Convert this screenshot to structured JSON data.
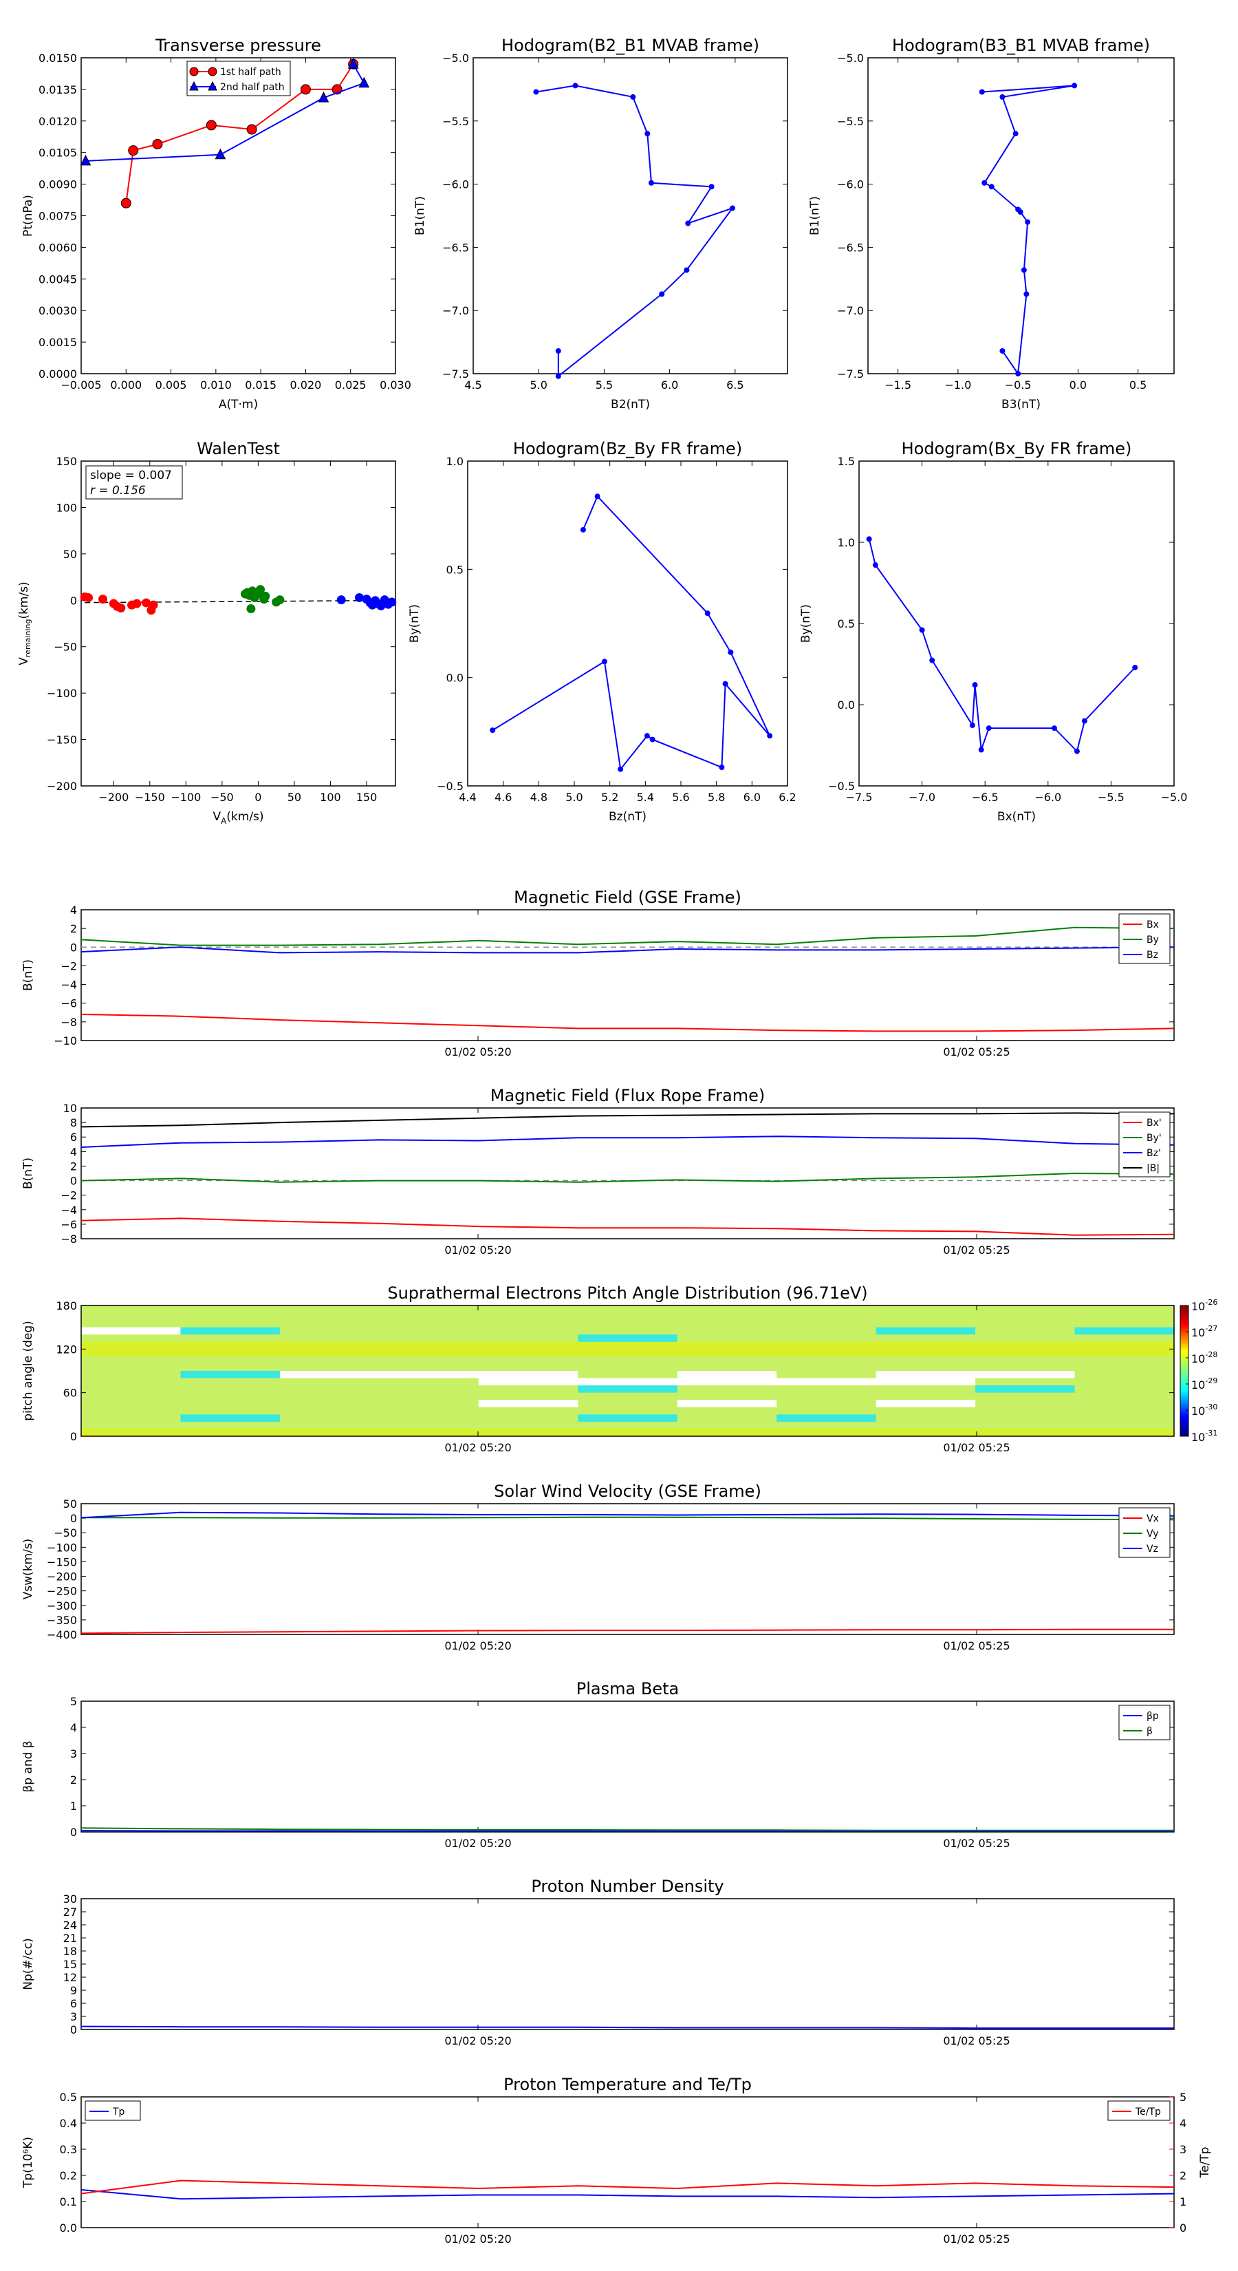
{
  "figure": {
    "background": "#ffffff"
  },
  "chart_data": [
    {
      "type": "line",
      "title": "Transverse pressure",
      "xlabel": "A(T·m)",
      "ylabel": "Pt(nPa)",
      "xlim": [
        -0.005,
        0.03
      ],
      "ylim": [
        0,
        0.015
      ],
      "xticks": [
        "−0.005",
        "0.000",
        "0.005",
        "0.010",
        "0.015",
        "0.020",
        "0.025",
        "0.030"
      ],
      "yticks": [
        "0.0000",
        "0.0015",
        "0.0030",
        "0.0045",
        "0.0060",
        "0.0075",
        "0.0090",
        "0.0105",
        "0.0120",
        "0.0135",
        "0.0150"
      ],
      "legend": "upper-center",
      "series": [
        {
          "name": "1st half path",
          "color": "#ff0000",
          "marker": "circle",
          "x": [
            0.0,
            0.0008,
            0.0035,
            0.0095,
            0.014,
            0.02,
            0.0235,
            0.0253
          ],
          "y": [
            0.0081,
            0.0106,
            0.0109,
            0.0118,
            0.0116,
            0.0135,
            0.0135,
            0.0147
          ]
        },
        {
          "name": "2nd half path",
          "color": "#0000ff",
          "marker": "triangle",
          "x": [
            -0.0045,
            0.0105,
            0.022,
            0.0265,
            0.0253
          ],
          "y": [
            0.0101,
            0.0104,
            0.0131,
            0.0138,
            0.0147
          ]
        }
      ]
    },
    {
      "type": "line",
      "title": "Hodogram(B2_B1 MVAB frame)",
      "xlabel": "B2(nT)",
      "ylabel": "B1(nT)",
      "xlim": [
        4.5,
        6.9
      ],
      "ylim": [
        -7.5,
        -5.0
      ],
      "xticks": [
        "4.5",
        "5.0",
        "5.5",
        "6.0",
        "6.5"
      ],
      "yticks": [
        "−7.5",
        "−7.0",
        "−6.5",
        "−6.0",
        "−5.5",
        "−5.0"
      ],
      "series": [
        {
          "color": "#0000ff",
          "x": [
            5.15,
            5.15,
            5.94,
            6.13,
            6.48,
            6.14,
            6.32,
            5.86,
            5.83,
            5.72,
            5.28,
            4.98
          ],
          "y": [
            -7.32,
            -7.52,
            -6.87,
            -6.68,
            -6.19,
            -6.31,
            -6.02,
            -5.99,
            -5.6,
            -5.31,
            -5.22,
            -5.27
          ]
        }
      ]
    },
    {
      "type": "line",
      "title": "Hodogram(B3_B1 MVAB frame)",
      "xlabel": "B3(nT)",
      "ylabel": "B1(nT)",
      "xlim": [
        -1.75,
        0.8
      ],
      "ylim": [
        -7.5,
        -5.0
      ],
      "xticks": [
        "−1.5",
        "−1.0",
        "−0.5",
        "0.0",
        "0.5"
      ],
      "yticks": [
        "−7.5",
        "−7.0",
        "−6.5",
        "−6.0",
        "−5.5",
        "−5.0"
      ],
      "series": [
        {
          "color": "#0000ff",
          "x": [
            -0.63,
            -0.5,
            -0.43,
            -0.45,
            -0.42,
            -0.48,
            -0.5,
            -0.72,
            -0.78,
            -0.52,
            -0.63,
            -0.03,
            -0.8
          ],
          "y": [
            -7.32,
            -7.5,
            -6.87,
            -6.68,
            -6.3,
            -6.22,
            -6.2,
            -6.02,
            -5.99,
            -5.6,
            -5.31,
            -5.22,
            -5.27
          ]
        }
      ]
    },
    {
      "type": "scatter",
      "title": "WalenTest",
      "xlabel": "V",
      "xlabel_sub": "A",
      "xlabel_unit": "(km/s)",
      "ylabel": "V",
      "ylabel_sub": "remaining",
      "ylabel_unit": "(km/s)",
      "xlim": [
        -245,
        190
      ],
      "ylim": [
        -250,
        190
      ],
      "xticks": [
        "−200",
        "−150",
        "−100",
        "−50",
        "0",
        "50",
        "100",
        "150"
      ],
      "yticks": [
        "−200",
        "−150",
        "−100",
        "−50",
        "0",
        "50",
        "100",
        "150"
      ],
      "annotation": [
        "slope = 0.007",
        "r = 0.156"
      ],
      "fit_line": {
        "x": [
          -240,
          190
        ],
        "y": [
          -1.7,
          1.3
        ],
        "color": "#000000",
        "dashed": true
      },
      "series": [
        {
          "color": "#ff0000",
          "x": [
            -240,
            -235,
            -215,
            -200,
            -195,
            -190,
            -175,
            -168,
            -155,
            -148,
            -145
          ],
          "y": [
            6,
            5,
            3,
            -3,
            -7,
            -9,
            -5,
            -3,
            -2,
            -12,
            -5
          ]
        },
        {
          "color": "#008000",
          "x": [
            -18,
            -15,
            -12,
            -10,
            -8,
            -5,
            0,
            3,
            8,
            10,
            25,
            30
          ],
          "y": [
            10,
            12,
            8,
            -10,
            14,
            5,
            10,
            16,
            3,
            7,
            -1,
            2
          ]
        },
        {
          "color": "#0000ff",
          "x": [
            115,
            140,
            150,
            155,
            158,
            162,
            165,
            170,
            175,
            180,
            185
          ],
          "y": [
            2,
            5,
            3,
            -2,
            -5,
            1,
            -3,
            -6,
            2,
            -4,
            -1
          ]
        }
      ]
    },
    {
      "type": "line",
      "title": "Hodogram(Bz_By FR frame)",
      "xlabel": "Bz(nT)",
      "ylabel": "By(nT)",
      "xlim": [
        4.4,
        6.2
      ],
      "ylim": [
        -0.55,
        1.2
      ],
      "xticks": [
        "4.4",
        "4.6",
        "4.8",
        "5.0",
        "5.2",
        "5.4",
        "5.6",
        "5.8",
        "6.0",
        "6.2"
      ],
      "yticks": [
        "−0.5",
        "0.0",
        "0.5",
        "1.0"
      ],
      "series": [
        {
          "color": "#0000ff",
          "x": [
            5.05,
            5.13,
            5.75,
            5.88,
            6.1,
            5.85,
            5.83,
            5.44,
            5.41,
            5.26,
            5.17,
            4.54
          ],
          "y": [
            0.83,
            1.01,
            0.38,
            0.17,
            -0.28,
            0.0,
            -0.45,
            -0.3,
            -0.28,
            -0.46,
            0.12,
            -0.25
          ]
        }
      ]
    },
    {
      "type": "line",
      "title": "Hodogram(Bx_By FR frame)",
      "xlabel": "Bx(nT)",
      "ylabel": "By(nT)",
      "xlim": [
        -7.5,
        -5.0
      ],
      "ylim": [
        -0.7,
        1.55
      ],
      "xticks": [
        "−7.5",
        "−7.0",
        "−6.5",
        "−6.0",
        "−5.5",
        "−5.0"
      ],
      "yticks": [
        "−0.5",
        "0.0",
        "0.5",
        "1.0",
        "1.5"
      ],
      "series": [
        {
          "color": "#0000ff",
          "x": [
            -7.42,
            -7.37,
            -7.0,
            -6.92,
            -6.6,
            -6.58,
            -6.53,
            -6.47,
            -5.95,
            -5.77,
            -5.71,
            -5.31
          ],
          "y": [
            1.01,
            0.83,
            0.38,
            0.17,
            -0.28,
            0.0,
            -0.45,
            -0.3,
            -0.3,
            -0.46,
            -0.25,
            0.12
          ]
        }
      ]
    },
    {
      "type": "line",
      "title": "Magnetic Field (GSE Frame)",
      "ylabel": "B(nT)",
      "ylim": [
        -10,
        4
      ],
      "yticks": [
        "−10",
        "−8",
        "−6",
        "−4",
        "−2",
        "0",
        "2",
        "4"
      ],
      "timeticks": [
        "01/02 05:20",
        "01/02 05:25"
      ],
      "legend": "top-right",
      "zero_line": true,
      "series": [
        {
          "name": "Bx",
          "color": "#ff0000",
          "values": [
            -7.2,
            -7.4,
            -7.8,
            -8.1,
            -8.4,
            -8.7,
            -8.7,
            -8.9,
            -9.0,
            -9.0,
            -8.9,
            -8.7
          ]
        },
        {
          "name": "By",
          "color": "#008000",
          "values": [
            0.8,
            0.2,
            0.2,
            0.3,
            0.7,
            0.3,
            0.6,
            0.3,
            1.0,
            1.2,
            2.1,
            2.0
          ]
        },
        {
          "name": "Bz",
          "color": "#0000ff",
          "values": [
            -0.5,
            0.0,
            -0.6,
            -0.5,
            -0.6,
            -0.6,
            -0.2,
            -0.3,
            -0.3,
            -0.2,
            -0.1,
            0.0
          ]
        }
      ]
    },
    {
      "type": "line",
      "title": "Magnetic Field (Flux Rope Frame)",
      "ylabel": "B(nT)",
      "ylim": [
        -8,
        10
      ],
      "yticks": [
        "−8",
        "−6",
        "−4",
        "−2",
        "0",
        "2",
        "4",
        "6",
        "8",
        "10"
      ],
      "timeticks": [
        "01/02 05:20",
        "01/02 05:25"
      ],
      "legend": "top-right",
      "zero_line": true,
      "series": [
        {
          "name": "Bx'",
          "color": "#ff0000",
          "values": [
            -5.5,
            -5.2,
            -5.6,
            -5.9,
            -6.3,
            -6.5,
            -6.5,
            -6.6,
            -6.9,
            -7.0,
            -7.5,
            -7.4
          ]
        },
        {
          "name": "By'",
          "color": "#008000",
          "values": [
            0.0,
            0.3,
            -0.2,
            0.0,
            0.0,
            -0.2,
            0.1,
            -0.1,
            0.3,
            0.5,
            1.0,
            0.9
          ]
        },
        {
          "name": "Bz'",
          "color": "#0000ff",
          "values": [
            4.6,
            5.2,
            5.3,
            5.6,
            5.5,
            5.9,
            5.9,
            6.1,
            5.9,
            5.8,
            5.1,
            4.9
          ]
        },
        {
          "name": "|B|",
          "color": "#000000",
          "values": [
            7.4,
            7.6,
            8.0,
            8.3,
            8.6,
            8.9,
            9.0,
            9.1,
            9.2,
            9.2,
            9.3,
            9.2
          ]
        }
      ]
    },
    {
      "type": "heatmap",
      "title": "Suprathermal Electrons Pitch Angle Distribution (96.71eV)",
      "ylabel": "pitch angle (deg)",
      "ylim": [
        0,
        180
      ],
      "yticks": [
        "0",
        "60",
        "120",
        "180"
      ],
      "timeticks": [
        "01/02 05:20",
        "01/02 05:25"
      ],
      "colorbar_ticks": [
        "10",
        "10",
        "10",
        "10",
        "10",
        "10"
      ],
      "colorbar_exps": [
        "-31",
        "-30",
        "-29",
        "-28",
        "-27",
        "-26"
      ],
      "columns": 11,
      "rows": 18,
      "cells": [
        "LLLLLLLLLLL",
        "LLLLLLLLLLL",
        "LLLLLLLLLLL",
        "WCLLLLLLCLC",
        "LLLLLCLLLLL",
        "YYYYYYYYYYY",
        "YYYYYYYYYYY",
        "LLLLLLLLLLL",
        "LLLLLLLLLLL",
        "LCWWWLWLWWL",
        "LLLLWWWWWLL",
        "LLLLLCLLLCL",
        "LLLLLLLLLLL",
        "LLLLWLWLWLL",
        "LLLLLLLLLLL",
        "LCLLLCLCLLL",
        "LLLLLLLLLLL",
        "YYYYYYYYYYY"
      ]
    },
    {
      "type": "line",
      "title": "Solar Wind Velocity (GSE Frame)",
      "ylabel": "Vsw(km/s)",
      "ylim": [
        -400,
        50
      ],
      "yticks": [
        "−400",
        "−350",
        "−300",
        "−250",
        "−200",
        "−150",
        "−100",
        "−50",
        "0",
        "50"
      ],
      "timeticks": [
        "01/02 05:20",
        "01/02 05:25"
      ],
      "legend": "top-right",
      "series": [
        {
          "name": "Vx",
          "color": "#ff0000",
          "values": [
            -396,
            -393,
            -391,
            -389,
            -387,
            -386,
            -386,
            -385,
            -384,
            -384,
            -383,
            -383
          ]
        },
        {
          "name": "Vy",
          "color": "#008000",
          "values": [
            2,
            2,
            1,
            1,
            2,
            3,
            3,
            2,
            0,
            -2,
            -4,
            -5
          ]
        },
        {
          "name": "Vz",
          "color": "#0000ff",
          "values": [
            2,
            20,
            18,
            14,
            12,
            12,
            11,
            12,
            14,
            13,
            10,
            8
          ]
        }
      ]
    },
    {
      "type": "line",
      "title": "Plasma Beta",
      "ylabel": "βp and β",
      "ylim": [
        0,
        5
      ],
      "yticks": [
        "0",
        "1",
        "2",
        "3",
        "4",
        "5"
      ],
      "timeticks": [
        "01/02 05:20",
        "01/02 05:25"
      ],
      "legend": "top-right",
      "series": [
        {
          "name": "βp",
          "color": "#0000ff",
          "values": [
            0.05,
            0.04,
            0.04,
            0.03,
            0.03,
            0.03,
            0.03,
            0.03,
            0.03,
            0.03,
            0.03,
            0.03
          ]
        },
        {
          "name": "β",
          "color": "#008000",
          "values": [
            0.15,
            0.12,
            0.1,
            0.09,
            0.08,
            0.08,
            0.07,
            0.07,
            0.06,
            0.06,
            0.06,
            0.06
          ]
        }
      ]
    },
    {
      "type": "line",
      "title": "Proton Number Density",
      "ylabel": "Np(#/cc)",
      "ylim": [
        0,
        30
      ],
      "yticks": [
        "0",
        "3",
        "6",
        "9",
        "12",
        "15",
        "18",
        "21",
        "24",
        "27",
        "30"
      ],
      "timeticks": [
        "01/02 05:20",
        "01/02 05:25"
      ],
      "series": [
        {
          "color": "#0000ff",
          "values": [
            0.7,
            0.6,
            0.6,
            0.5,
            0.5,
            0.5,
            0.4,
            0.4,
            0.4,
            0.3,
            0.3,
            0.3
          ]
        }
      ]
    },
    {
      "type": "line",
      "title": "Proton Temperature and Te/Tp",
      "ylabel": "Tp(10⁶K)",
      "y2label": "Te/Tp",
      "ylim": [
        0,
        0.5
      ],
      "y2lim": [
        0,
        5
      ],
      "yticks": [
        "0.0",
        "0.1",
        "0.2",
        "0.3",
        "0.4",
        "0.5"
      ],
      "y2ticks": [
        "0",
        "1",
        "2",
        "3",
        "4",
        "5"
      ],
      "timeticks": [
        "01/02 05:20",
        "01/02 05:25"
      ],
      "series": [
        {
          "name": "Tp",
          "axis": "left",
          "color": "#0000ff",
          "values": [
            0.145,
            0.11,
            0.115,
            0.12,
            0.125,
            0.125,
            0.12,
            0.12,
            0.115,
            0.12,
            0.125,
            0.13
          ]
        },
        {
          "name": "Te/Tp",
          "axis": "right",
          "color": "#ff0000",
          "values": [
            1.3,
            1.8,
            1.7,
            1.6,
            1.5,
            1.6,
            1.5,
            1.7,
            1.6,
            1.7,
            1.6,
            1.55
          ]
        }
      ]
    }
  ]
}
